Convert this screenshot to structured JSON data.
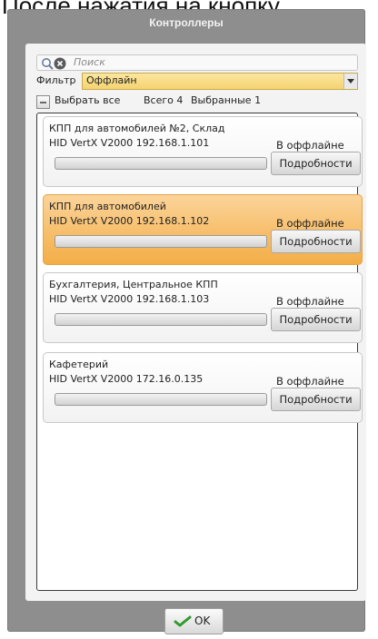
{
  "caption": "После нажатия на кнопку",
  "window": {
    "title": "Контроллеры"
  },
  "search": {
    "placeholder": "Поиск"
  },
  "filter": {
    "label": "Фильтр",
    "value": "Оффлайн"
  },
  "selection": {
    "select_all": "Выбрать все",
    "total": "Всего 4",
    "selected": "Выбранные 1"
  },
  "controllers": [
    {
      "name": "КПП для автомобилей №2, Склад",
      "address": "HID VertX V2000 192.168.1.101",
      "status": "В оффлайне",
      "button": "Подробности",
      "selected": false,
      "progress": 0
    },
    {
      "name": "КПП для автомобилей",
      "address": "HID VertX V2000 192.168.1.102",
      "status": "В оффлайне",
      "button": "Подробности",
      "selected": true,
      "progress": 0
    },
    {
      "name": "Бухгалтерия, Центральное КПП",
      "address": "HID VertX V2000 192.168.1.103",
      "status": "В оффлайне",
      "button": "Подробности",
      "selected": false,
      "progress": 0
    },
    {
      "name": "Кафетерий",
      "address": "HID VertX V2000 172.16.0.135",
      "status": "В оффлайне",
      "button": "Подробности",
      "selected": false,
      "progress": 0
    }
  ],
  "ok_button": {
    "label": "OK",
    "icon": "checkmark-icon"
  },
  "colors": {
    "selected_card": "#f3ad45",
    "filter_highlight": "#f6d370",
    "window_bg": "#8e8e8e"
  }
}
